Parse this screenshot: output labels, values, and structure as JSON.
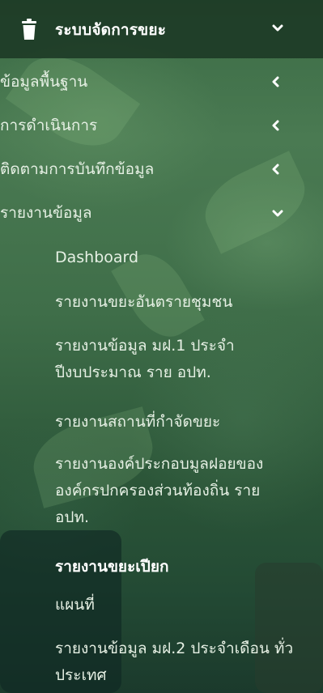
{
  "header": {
    "title": "ระบบจัดการขยะ",
    "icon": "trash-icon",
    "chevron": "chevron-down-icon"
  },
  "menu": [
    {
      "label": "ข้อมูลพื้นฐาน",
      "chevron": "chevron-left-icon"
    },
    {
      "label": "การดำเนินการ",
      "chevron": "chevron-left-icon"
    },
    {
      "label": "ติดตามการบันทึกข้อมูล",
      "chevron": "chevron-left-icon"
    },
    {
      "label": "รายงานข้อมูล",
      "chevron": "chevron-down-icon"
    }
  ],
  "submenu": [
    {
      "label": "Dashboard",
      "active": false
    },
    {
      "label": "รายงานขยะอันตรายชุมชน",
      "active": false
    },
    {
      "label": "รายงานข้อมูล มฝ.1 ประจำปีงบประมาณ ราย อปท.",
      "active": false
    },
    {
      "label": "รายงานสถานที่กำจัดขยะ",
      "active": false
    },
    {
      "label": "รายงานองค์ประกอบมูลฝอยขององค์กรปกครองส่วนท้องถิ่น ราย อปท.",
      "active": false
    },
    {
      "label": "รายงานขยะเปียก",
      "active": true
    },
    {
      "label": "แผนที่",
      "active": false
    },
    {
      "label": "รายงานข้อมูล มฝ.2 ประจำเดือน ทั่วประเทศ",
      "active": false
    }
  ],
  "colors": {
    "text": "#e6f0e4",
    "active_text": "#ffffff",
    "header_bg": "#1a3422"
  }
}
